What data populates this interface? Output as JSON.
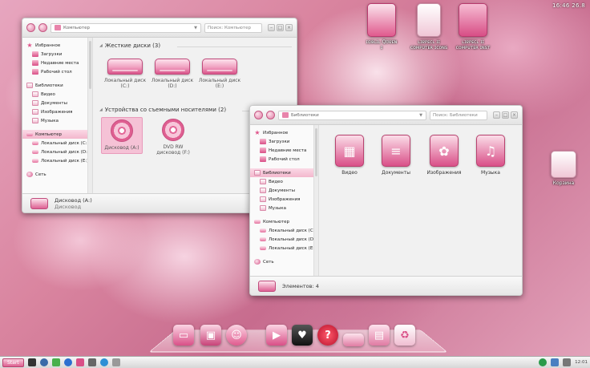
{
  "desktop": {
    "icons": [
      {
        "label": "ɪɑɘʟɪʟ Qʊɐᴇɴ\nɪ",
        "name": "desktop-icon-folder-queen"
      },
      {
        "label": "ʟɪɐᴘᴇᴄʟ ɪɪ\nᴄᴏᴍᴘᴜᴛᴇʀ ɪᴄᴏɴꜱ",
        "name": "desktop-icon-folder-docs"
      },
      {
        "label": "ʟɪɐᴘᴇᴄʟ ɪɪ\nᴄᴏᴍᴘᴜᴛᴇʀ ɪɴꜱᴛ",
        "name": "desktop-icon-folder-books"
      },
      {
        "label": "Корзина",
        "name": "recycle-bin-icon"
      }
    ],
    "clock": "16:46  26.8"
  },
  "computer_window": {
    "address": "Компьютер",
    "search_placeholder": "Поиск: Компьютер",
    "nav": {
      "favorites": "Избранное",
      "downloads": "Загрузки",
      "recent": "Недавние места",
      "desktop": "Рабочий стол",
      "libraries": "Библиотеки",
      "video": "Видео",
      "documents": "Документы",
      "images": "Изображения",
      "music": "Музыка",
      "computer": "Компьютер",
      "disk_c": "Локальный диск (C:)",
      "disk_d": "Локальный диск (D:)",
      "disk_e": "Локальный диск (E:)",
      "network": "Сеть"
    },
    "hard_drives_title": "Жесткие диски (3)",
    "drives": [
      {
        "name": "Локальный диск",
        "letter": "(C:)"
      },
      {
        "name": "Локальный диск",
        "letter": "(D:)"
      },
      {
        "name": "Локальный диск",
        "letter": "(E:)"
      }
    ],
    "removable_title": "Устройства со съемными носителями (2)",
    "removable": [
      {
        "name": "Дисковод (A:)",
        "letter": ""
      },
      {
        "name": "DVD RW",
        "letter": "дисковод (F:)"
      }
    ],
    "status": {
      "line1": "Дисковод (A:)",
      "line2": "Дисковод"
    }
  },
  "libraries_window": {
    "address": "Библиотеки",
    "search_placeholder": "Поиск: Библиотеки",
    "nav": {
      "favorites": "Избранное",
      "downloads": "Загрузки",
      "recent": "Недавние места",
      "desktop": "Рабочий стол",
      "libraries": "Библиотеки",
      "video": "Видео",
      "documents": "Документы",
      "images": "Изображения",
      "music": "Музыка",
      "computer": "Компьютер",
      "disk_c": "Локальный диск (C:)",
      "disk_d": "Локальный диск (D:)",
      "disk_e": "Локальный диск (E:)",
      "network": "Сеть"
    },
    "tiles": [
      "Видео",
      "Документы",
      "Изображения",
      "Музыка"
    ],
    "status": "Элементов: 4"
  },
  "taskbar": {
    "start": "Start",
    "tray": "12:01"
  },
  "colors": {
    "accent": "#e0558b",
    "accent_dark": "#b8426f",
    "window_bg": "#f4f4f4"
  }
}
